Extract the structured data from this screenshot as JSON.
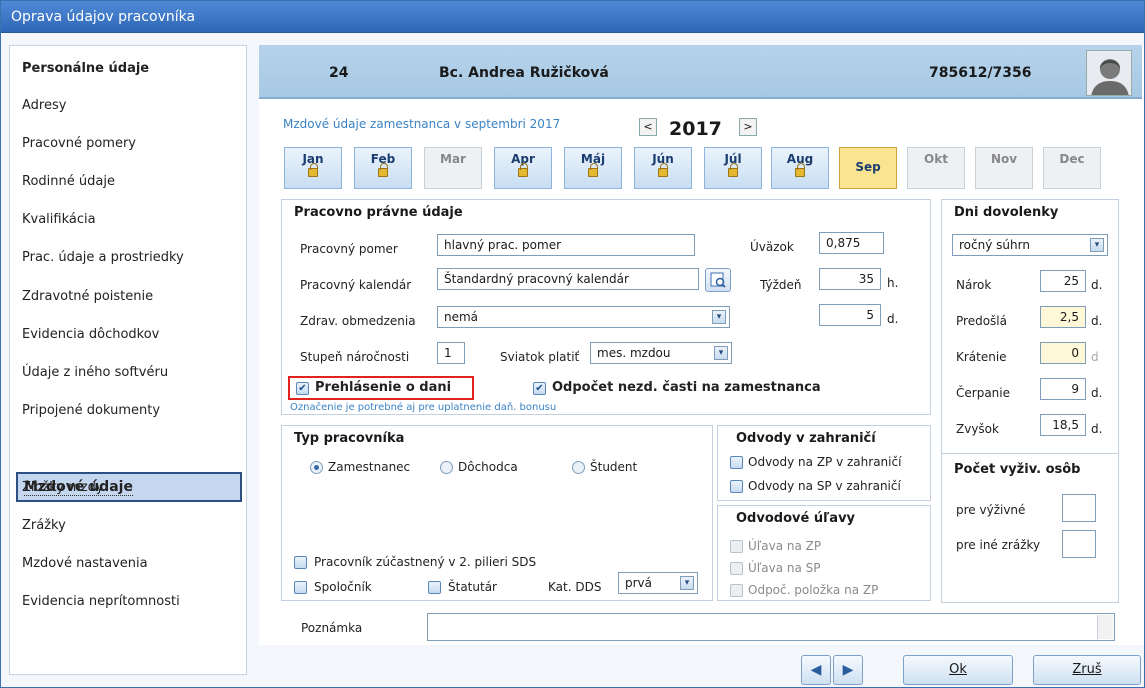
{
  "window": {
    "title": "Oprava údajov pracovníka"
  },
  "sidebar": {
    "items": [
      {
        "label": "Personálne údaje"
      },
      {
        "label": "Adresy"
      },
      {
        "label": "Pracovné pomery"
      },
      {
        "label": "Rodinné údaje"
      },
      {
        "label": "Kvalifikácia"
      },
      {
        "label": "Prac. údaje a prostriedky"
      },
      {
        "label": "Zdravotné poistenie"
      },
      {
        "label": "Evidencia dôchodkov"
      },
      {
        "label": "Údaje z iného softvéru"
      },
      {
        "label": "Pripojené dokumenty"
      },
      {
        "label": "Mzdové údaje"
      },
      {
        "label": "Zložky mzdy"
      },
      {
        "label": "Zrážky"
      },
      {
        "label": "Mzdové nastavenia"
      },
      {
        "label": "Evidencia neprítomnosti"
      }
    ]
  },
  "header": {
    "id": "24",
    "name": "Bc. Andrea Ružičková",
    "birth_number": "785612/7356",
    "avatar_icon": "person-silhouette-icon"
  },
  "period": {
    "subtitle": "Mzdové údaje zamestnanca v septembri 2017",
    "year": "2017",
    "prev": "<",
    "next": ">"
  },
  "months": [
    {
      "label": "Jan",
      "locked": true,
      "state": "normal"
    },
    {
      "label": "Feb",
      "locked": true,
      "state": "normal"
    },
    {
      "label": "Mar",
      "locked": false,
      "state": "disabled"
    },
    {
      "label": "Apr",
      "locked": true,
      "state": "normal"
    },
    {
      "label": "Máj",
      "locked": true,
      "state": "normal"
    },
    {
      "label": "Jún",
      "locked": true,
      "state": "normal"
    },
    {
      "label": "Júl",
      "locked": true,
      "state": "normal"
    },
    {
      "label": "Aug",
      "locked": true,
      "state": "normal"
    },
    {
      "label": "Sep",
      "locked": false,
      "state": "selected"
    },
    {
      "label": "Okt",
      "locked": false,
      "state": "disabled"
    },
    {
      "label": "Nov",
      "locked": false,
      "state": "disabled"
    },
    {
      "label": "Dec",
      "locked": false,
      "state": "disabled"
    }
  ],
  "labor": {
    "title": "Pracovno právne údaje",
    "employment_label": "Pracovný pomer",
    "employment_value": "hlavný prac. pomer",
    "calendar_label": "Pracovný kalendár",
    "calendar_value": "Štandardný pracovný kalendár",
    "health_label": "Zdrav. obmedzenia",
    "health_value": "nemá",
    "difficulty_label": "Stupeň náročnosti",
    "difficulty_value": "1",
    "holiday_label": "Sviatok platiť",
    "holiday_value": "mes. mzdou",
    "workload_label": "Úväzok",
    "workload_value": "0,875",
    "week_label": "Týždeň",
    "week_value": "35",
    "week_unit": "h.",
    "days_value": "5",
    "days_unit": "d.",
    "tax_decl_label": "Prehlásenie o dani",
    "deduction_label": "Odpočet nezd. časti na zamestnanca",
    "hint": "Označenie je potrebné aj pre uplatnenie daň. bonusu"
  },
  "vacation": {
    "title": "Dni dovolenky",
    "mode": "ročný súhrn",
    "rows": [
      {
        "label": "Nárok",
        "value": "25",
        "unit": "d."
      },
      {
        "label": "Predošlá",
        "value": "2,5",
        "unit": "d."
      },
      {
        "label": "Krátenie",
        "value": "0",
        "unit": "d"
      },
      {
        "label": "Čerpanie",
        "value": "9",
        "unit": "d."
      },
      {
        "label": "Zvyšok",
        "value": "18,5",
        "unit": "d."
      }
    ]
  },
  "worker_type": {
    "title": "Typ pracovníka",
    "opts": [
      "Zamestnanec",
      "Dôchodca",
      "Študent"
    ],
    "selected": "Zamestnanec",
    "sds_label": "Pracovník zúčastnený v 2. pilieri SDS",
    "partner_label": "Spoločník",
    "statutory_label": "Štatutár",
    "dds_label": "Kat. DDS",
    "dds_value": "prvá"
  },
  "abroad": {
    "title": "Odvody v zahraničí",
    "zp": "Odvody na ZP v zahraničí",
    "sp": "Odvody na SP v zahraničí"
  },
  "relief": {
    "title": "Odvodové úľavy",
    "zp": "Úľava na ZP",
    "sp": "Úľava na SP",
    "item": "Odpoč. položka na ZP"
  },
  "dependents": {
    "title": "Počet vyživ. osôb",
    "support": "pre výživné",
    "other": "pre iné zrážky"
  },
  "note": {
    "label": "Poznámka",
    "value": ""
  },
  "footer": {
    "ok": "Ok",
    "cancel": "Zruš"
  }
}
